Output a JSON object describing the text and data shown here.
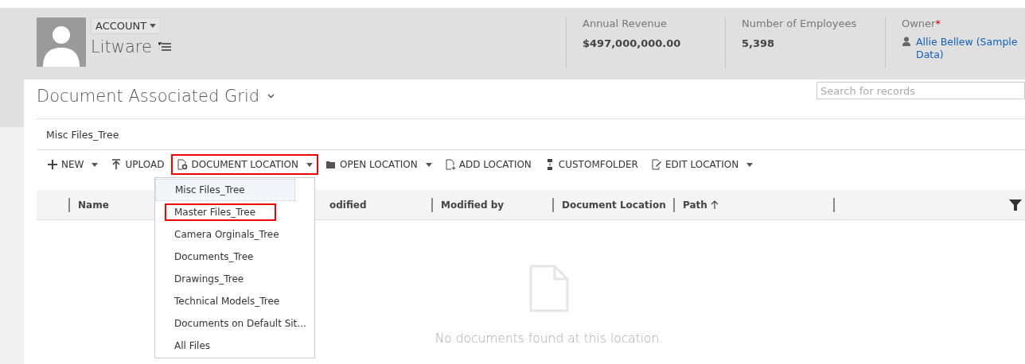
{
  "header": {
    "entity_button": "ACCOUNT",
    "record_name": "Litware",
    "fields": [
      {
        "label": "Annual Revenue",
        "value": "$497,000,000.00",
        "kind": "text"
      },
      {
        "label": "Number of Employees",
        "value": "5,398",
        "kind": "text"
      },
      {
        "label": "Owner",
        "value": "Allie Bellew (Sample Data)",
        "kind": "owner",
        "required_mark": "*"
      }
    ]
  },
  "grid": {
    "title": "Document Associated Grid",
    "search": {
      "placeholder": "Search for records"
    },
    "location": "Misc Files_Tree",
    "toolbar": [
      {
        "label": "NEW",
        "kind": "plus",
        "dropdown": true,
        "highlighted": false
      },
      {
        "label": "UPLOAD",
        "kind": "upload",
        "dropdown": false,
        "highlighted": false
      },
      {
        "label": "DOCUMENT LOCATION",
        "kind": "docgear",
        "dropdown": true,
        "highlighted": true
      },
      {
        "label": "OPEN LOCATION",
        "kind": "folder",
        "dropdown": true,
        "highlighted": false
      },
      {
        "label": "ADD LOCATION",
        "kind": "docplus",
        "dropdown": false,
        "highlighted": false
      },
      {
        "label": "CUSTOMFOLDER",
        "kind": "custom",
        "dropdown": false,
        "highlighted": false
      },
      {
        "label": "EDIT LOCATION",
        "kind": "edit",
        "dropdown": true,
        "highlighted": false
      }
    ],
    "menu": [
      {
        "label": "Misc Files_Tree",
        "selected": true,
        "highlighted": false
      },
      {
        "label": "Master Files_Tree",
        "selected": false,
        "highlighted": true
      },
      {
        "label": "Camera Orginals_Tree",
        "selected": false,
        "highlighted": false
      },
      {
        "label": "Documents_Tree",
        "selected": false,
        "highlighted": false
      },
      {
        "label": "Drawings_Tree",
        "selected": false,
        "highlighted": false
      },
      {
        "label": "Technical Models_Tree",
        "selected": false,
        "highlighted": false
      },
      {
        "label": "Documents on Default Sit...",
        "selected": false,
        "highlighted": false
      },
      {
        "label": "All Files",
        "selected": false,
        "highlighted": false
      }
    ],
    "columns": [
      {
        "label": "Name",
        "sorted": false
      },
      {
        "label": "odified",
        "sorted": false
      },
      {
        "label": "Modified by",
        "sorted": false
      },
      {
        "label": "Document Location",
        "sorted": false
      },
      {
        "label": "Path",
        "sorted": true
      }
    ],
    "empty_message": "No documents found at this location."
  }
}
